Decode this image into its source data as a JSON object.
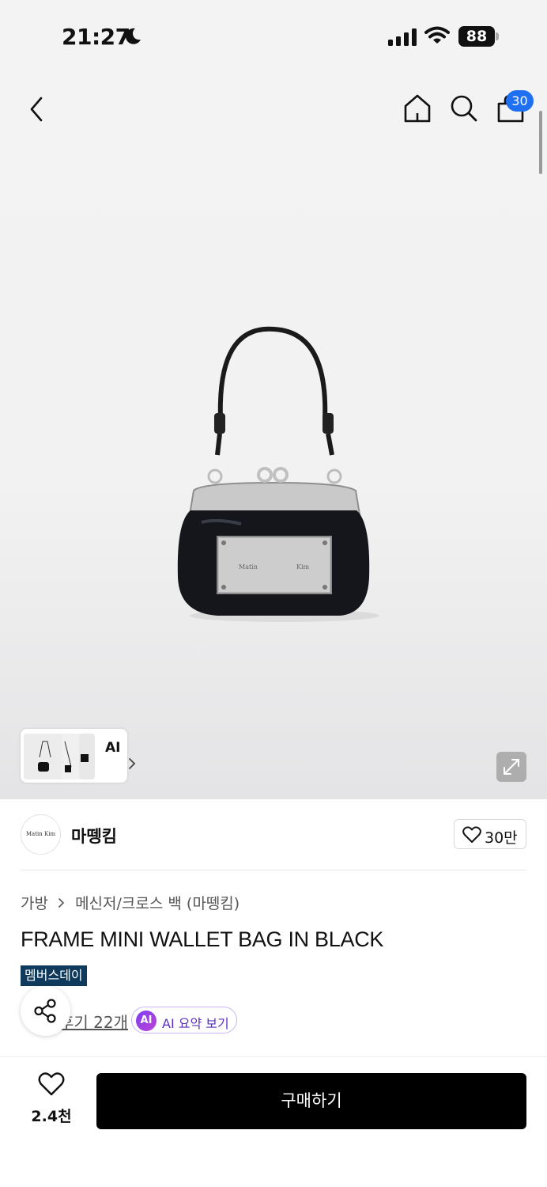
{
  "status_bar": {
    "time": "21:27",
    "battery": "88"
  },
  "header": {
    "cart_count": "30"
  },
  "gallery": {
    "ai_label": "AI"
  },
  "brand": {
    "logo_text": "Matin   Kim",
    "name": "마뗑킴",
    "likes": "30만"
  },
  "product": {
    "breadcrumb": [
      "가방",
      "메신저/크로스 백 (마뗑킴)"
    ],
    "title": "FRAME MINI WALLET BAG IN BLACK",
    "badge": "멤버스데이",
    "reviews": "후기 22개",
    "ai_summary": {
      "icon_label": "AI",
      "label": "AI 요약 보기"
    }
  },
  "bottom_bar": {
    "like_count": "2.4천",
    "buy_label": "구매하기"
  },
  "colors": {
    "accent": "#1e6ff1",
    "badge_bg": "#0f3a5c",
    "buy_bg": "#000000",
    "ai_purple": "#5a2fc2"
  }
}
